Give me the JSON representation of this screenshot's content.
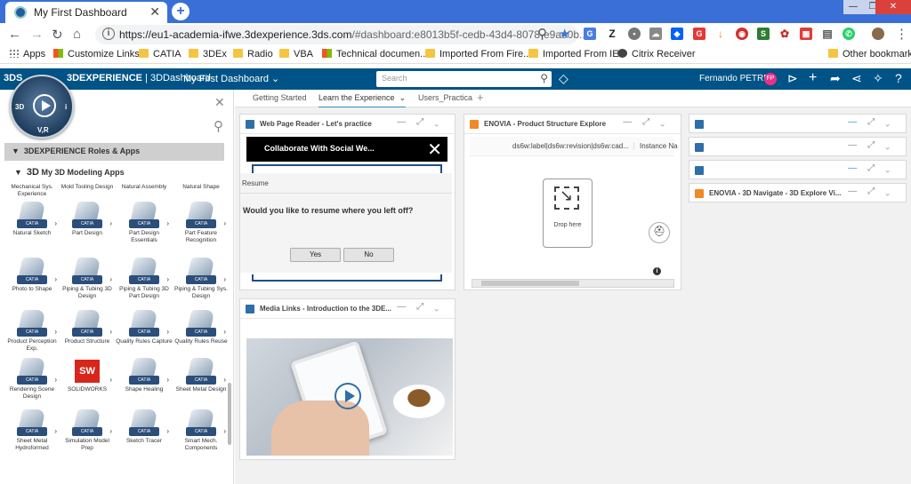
{
  "browser": {
    "tab_title": "My First Dashboard",
    "url_host": "https://eu1-academia-ifwe.3dexperience.3ds.com",
    "url_rest": "/#dashboard:e8013b5f-cedb-43d4-8078-e9ae0b...",
    "bookmarks": [
      "Apps",
      "Customize Links",
      "CATIA",
      "3DEx",
      "Radio",
      "VBA",
      "Technical documen...",
      "Imported From Fire...",
      "Imported From IE",
      "Citrix Receiver",
      "Other bookmarks"
    ]
  },
  "dx": {
    "brand_bold": "3DEXPERIENCE",
    "brand_thin": " | 3DDashboard",
    "dashboard_name": "My First Dashboard",
    "search_placeholder": "Search",
    "user_name": "Fernando PETRE",
    "user_initials": "FP"
  },
  "compass": {
    "left": "3D",
    "right": "i",
    "bottom": "V,R"
  },
  "left_panel": {
    "roles_header": "3DEXPERIENCE Roles & Apps",
    "apps_prefix": "3D",
    "apps_header": "My 3D Modeling Apps",
    "top_labels": [
      "Mechanical Sys. Experience",
      "Mold Tooling Design",
      "Natural Assembly",
      "Natural Shape"
    ],
    "apps": [
      "Natural Sketch",
      "Part Design",
      "Part Design Essentials",
      "Part Feature Recognition",
      "Photo to Shape",
      "Piping & Tubing 3D Design",
      "Piping & Tubing 3D Part Design",
      "Piping & Tubing Sys. Design",
      "Product Perception Exp.",
      "Product Structure",
      "Quality Rules Capture",
      "Quality Rules Reuse",
      "Rendering Scene Design",
      "SOLIDWORKS",
      "Shape Healing",
      "Sheet Metal Design",
      "Sheet Metal Hydroformed",
      "Simulation Model Prep",
      "Sketch Tracer",
      "Smart Mech. Components"
    ],
    "badge": "CATIA"
  },
  "tabs": [
    "Getting Started",
    "Learn the Experience",
    "Users_Practica"
  ],
  "widgets": {
    "wpr_title": "Web Page Reader - Let's practice",
    "wpr_modal_title": "Collaborate With Social We...",
    "wpr_resume": "Resume",
    "wpr_question": "Would you like to resume where you left off?",
    "wpr_yes": "Yes",
    "wpr_no": "No",
    "enovia_title": "ENOVIA - Product Structure Explore",
    "enovia_col1": "ds6w:label|ds6w:revision|ds6w:cad...",
    "enovia_col2": "Instance Na",
    "drop_here": "Drop here",
    "navigate_title": "ENOVIA - 3D Navigate - 3D Explore Vi...",
    "media_title": "Media Links - Introduction to the 3DE..."
  }
}
